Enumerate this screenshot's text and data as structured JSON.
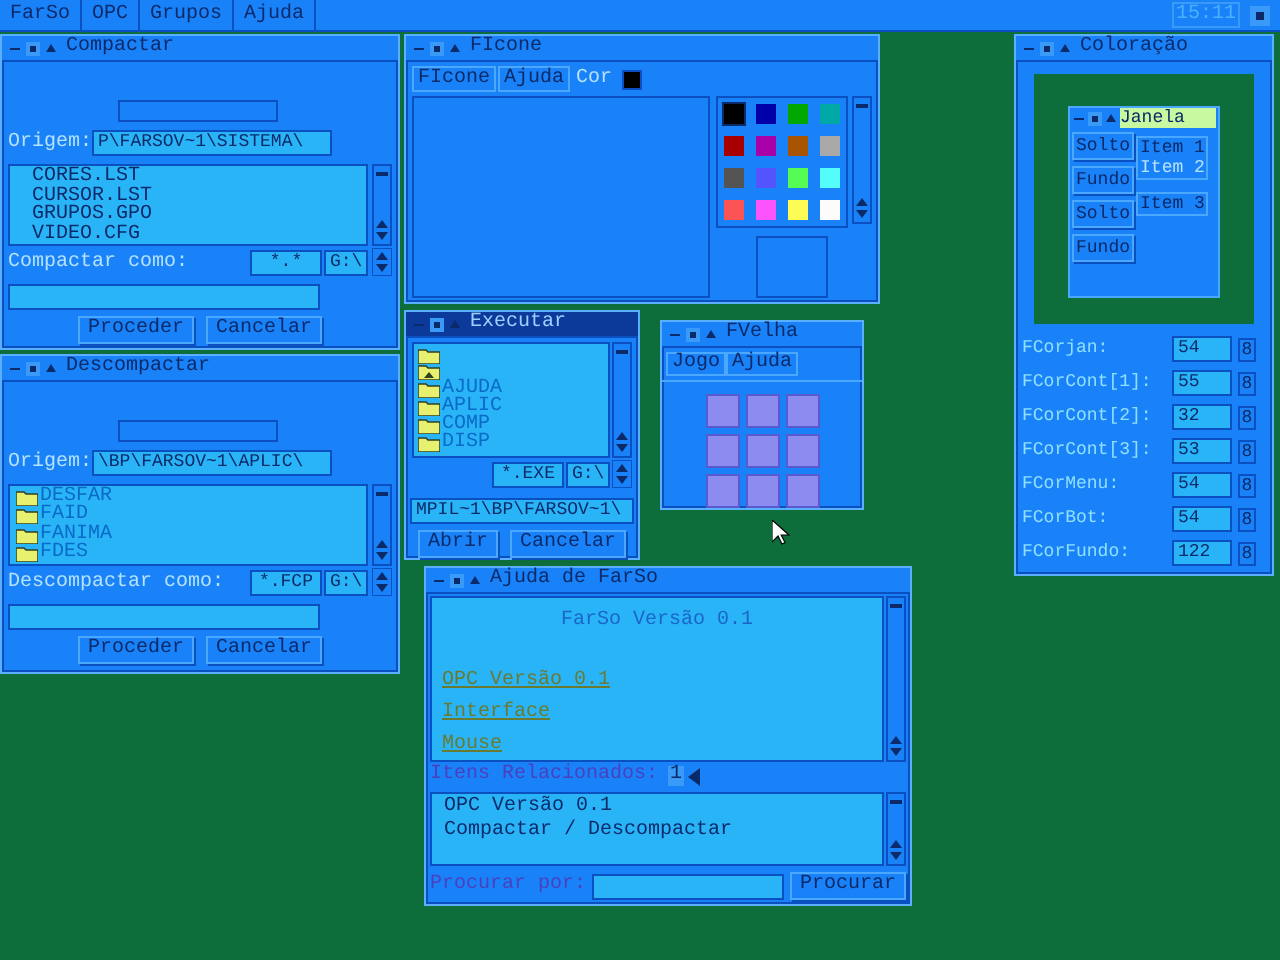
{
  "menu_bar": {
    "items": [
      "FarSo",
      "OPC",
      "Grupos",
      "Ajuda"
    ],
    "clock": "15:11"
  },
  "compactar": {
    "title": "Compactar",
    "active": false,
    "origin_label": "Origem:",
    "origin": "P\\FARSOV~1\\SISTEMA\\",
    "files": [
      "CORES.LST",
      "CURSOR.LST",
      "GRUPOS.GPO",
      "VIDEO.CFG"
    ],
    "mask": "*.*",
    "drive": "G:\\",
    "target_label": "Compactar como:",
    "buttons": [
      "Proceder",
      "Cancelar"
    ]
  },
  "descompactar": {
    "title": "Descompactar",
    "active": false,
    "origin_label": "Origem:",
    "origin": "\\BP\\FARSOV~1\\APLIC\\",
    "folders": [
      "DESFAR",
      "FAID",
      "FANIMA",
      "FDES"
    ],
    "mask": "*.FCP",
    "drive": "G:\\",
    "target_label": "Descompactar como:",
    "buttons": [
      "Proceder",
      "Cancelar"
    ]
  },
  "ficone": {
    "title": "FIcone",
    "active": false,
    "menu": [
      {
        "label": "FIcone",
        "disabled": false
      },
      {
        "label": "Ajuda",
        "disabled": false
      },
      {
        "label": "Cor",
        "disabled": true
      }
    ],
    "palette": [
      {
        "color": "#000000",
        "selected": true
      },
      {
        "color": "#0000a8",
        "selected": false
      },
      {
        "color": "#00a800",
        "selected": false
      },
      {
        "color": "#00a8a8",
        "selected": false
      },
      {
        "color": "#a80000",
        "selected": false
      },
      {
        "color": "#a800a8",
        "selected": false
      },
      {
        "color": "#a85400",
        "selected": false
      },
      {
        "color": "#a8a8a8",
        "selected": false
      },
      {
        "color": "#545454",
        "selected": false
      },
      {
        "color": "#5454fc",
        "selected": false
      },
      {
        "color": "#54fc54",
        "selected": false
      },
      {
        "color": "#54fcfc",
        "selected": false
      },
      {
        "color": "#fc5454",
        "selected": false
      },
      {
        "color": "#fc54fc",
        "selected": false
      },
      {
        "color": "#fcfc54",
        "selected": false
      },
      {
        "color": "#fcfcfc",
        "selected": false
      }
    ]
  },
  "executar": {
    "title": "Executar",
    "active": true,
    "entries": [
      {
        "kind": "folder"
      },
      {
        "kind": "parent"
      },
      {
        "kind": "folder",
        "name": "AJUDA"
      },
      {
        "kind": "folder",
        "name": "APLIC"
      },
      {
        "kind": "folder",
        "name": "COMP"
      },
      {
        "kind": "folder",
        "name": "DISP"
      }
    ],
    "mask": "*.EXE",
    "drive": "G:\\",
    "path": "MPIL~1\\BP\\FARSOV~1\\",
    "buttons": [
      "Abrir",
      "Cancelar"
    ]
  },
  "fvelha": {
    "title": "FVelha",
    "active": false,
    "menu": [
      "Jogo",
      "Ajuda"
    ]
  },
  "ajuda": {
    "title": "Ajuda de FarSo",
    "active": false,
    "heading": "FarSo Versão 0.1",
    "links": [
      "OPC Versão 0.1",
      "Interface",
      "Mouse"
    ],
    "related_label": "Itens Relacionados:",
    "related_count": "1",
    "related": [
      "OPC Versão 0.1",
      "Compactar / Descompactar"
    ],
    "search_label": "Procurar por:",
    "search_button": "Procurar"
  },
  "coloracao": {
    "title": "Coloração",
    "active": false,
    "preview": {
      "title": "Janela",
      "buttons": [
        "Solto",
        "Fundo",
        "Solto",
        "Fundo"
      ],
      "items": [
        {
          "label": "Item 1",
          "disabled": false
        },
        {
          "label": "Item 2",
          "disabled": true
        }
      ],
      "item_single": "Item 3"
    },
    "fields": [
      {
        "label": "FCorjan:",
        "value": "54",
        "spin": "8"
      },
      {
        "label": "FCorCont[1]:",
        "value": "55",
        "spin": "8"
      },
      {
        "label": "FCorCont[2]:",
        "value": "32",
        "spin": "8"
      },
      {
        "label": "FCorCont[3]:",
        "value": "53",
        "spin": "8"
      },
      {
        "label": "FCorMenu:",
        "value": "54",
        "spin": "8"
      },
      {
        "label": "FCorBot:",
        "value": "54",
        "spin": "8"
      },
      {
        "label": "FCorFundo:",
        "value": "122",
        "spin": "8"
      }
    ]
  }
}
